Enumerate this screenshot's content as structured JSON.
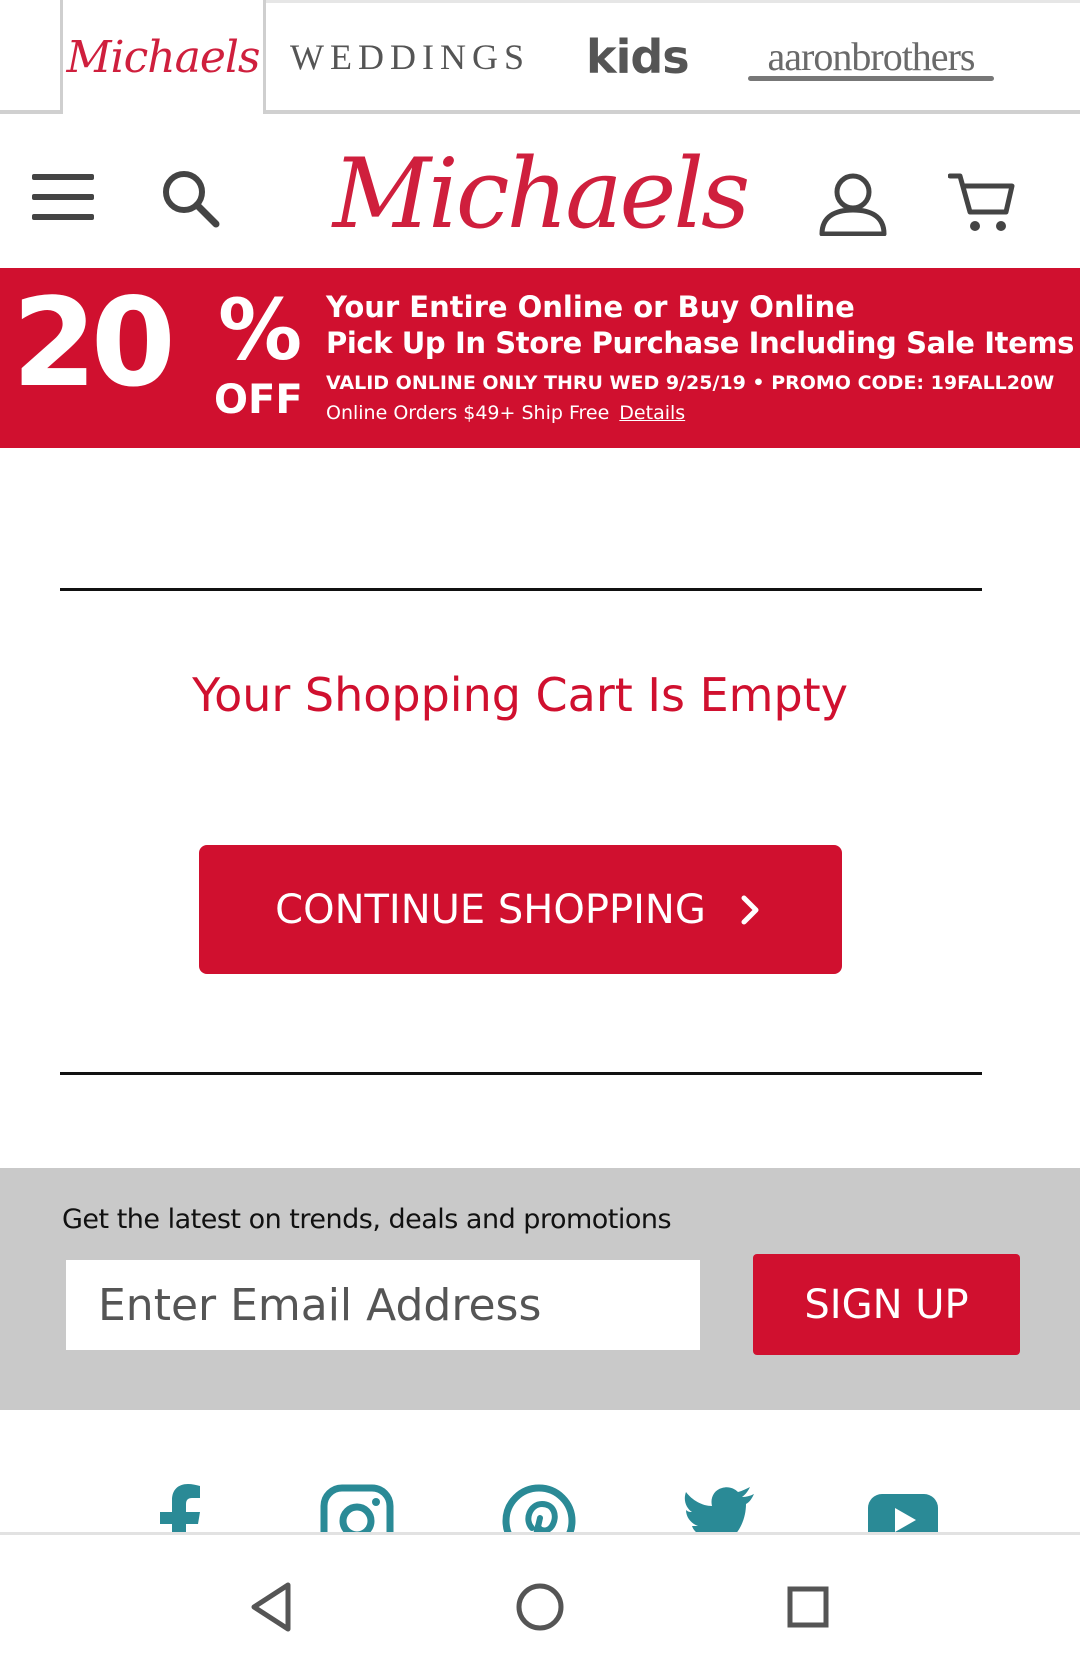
{
  "brand_tabs": {
    "michaels": "Michaels",
    "weddings": "WEDDINGS",
    "kids": "kids",
    "aaron_brothers": "aaronbrothers"
  },
  "header": {
    "logo": "Michaels",
    "icons": [
      "menu-icon",
      "search-icon",
      "account-icon",
      "cart-icon"
    ]
  },
  "promo": {
    "percent": "20",
    "percent_symbol": "%",
    "off": "OFF",
    "line1": "Your Entire Online or Buy Online",
    "line2": "Pick Up In Store Purchase Including Sale Items",
    "line3": "VALID ONLINE ONLY THRU WED 9/25/19 • PROMO CODE: 19FALL20W",
    "line4": "Online Orders $49+ Ship Free",
    "details_link": "Details"
  },
  "cart": {
    "empty_title": "Your Shopping Cart Is Empty",
    "continue_label": "CONTINUE SHOPPING"
  },
  "newsletter": {
    "caption": "Get the latest on trends, deals and promotions",
    "email_placeholder": "Enter Email Address",
    "signup_label": "SIGN UP"
  },
  "social": [
    "facebook-icon",
    "instagram-icon",
    "pinterest-icon",
    "twitter-icon",
    "youtube-icon"
  ],
  "colors": {
    "brand_red": "#d0102f",
    "social_teal": "#2a8a96",
    "newsletter_bg": "#c9c9c9"
  },
  "system_nav": [
    "back-icon",
    "home-icon",
    "recents-icon"
  ]
}
